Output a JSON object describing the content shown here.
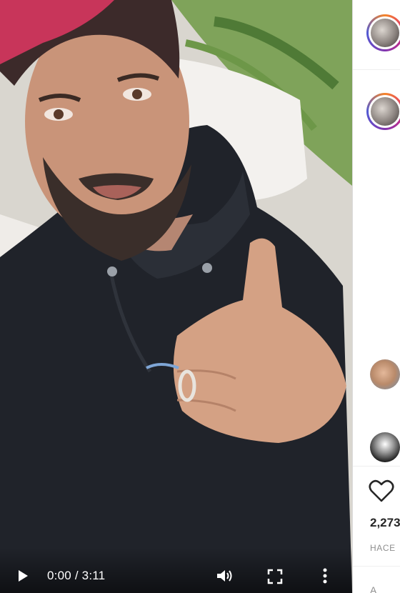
{
  "video": {
    "current_time": "0:00",
    "separator": " / ",
    "duration": "3:11",
    "play_icon": "play-icon",
    "volume_icon": "volume-icon",
    "fullscreen_icon": "fullscreen-icon",
    "more_icon": "more-vertical-icon"
  },
  "side": {
    "likes": "2,273",
    "date": "HACE",
    "add_comment": "A"
  },
  "colors": {
    "text_primary": "#262626",
    "text_secondary": "#8e8e8e",
    "divider": "#efefef"
  }
}
